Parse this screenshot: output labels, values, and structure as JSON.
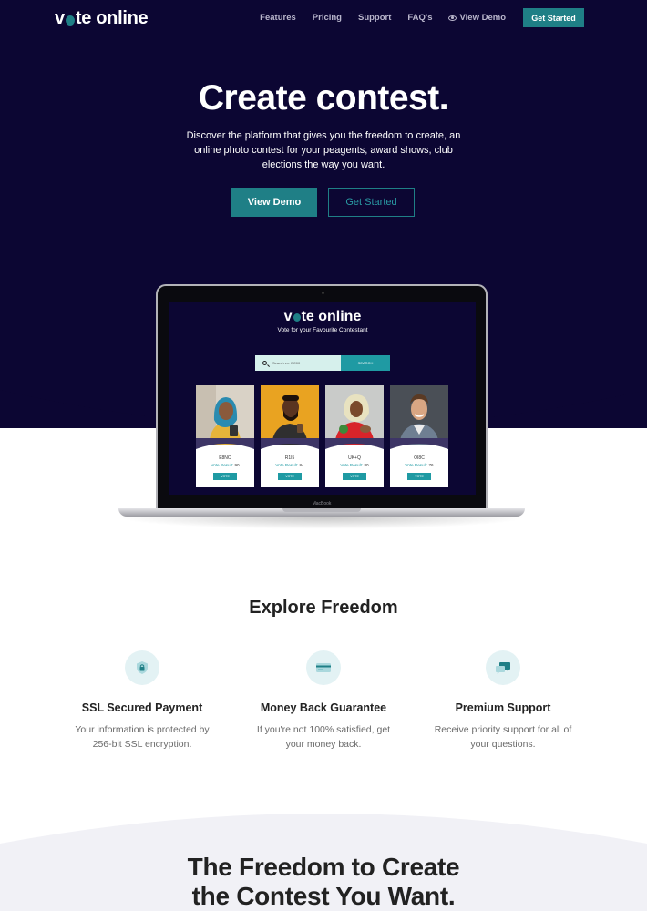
{
  "nav": {
    "logo_pre": "v",
    "logo_post": "te online",
    "links": [
      "Features",
      "Pricing",
      "Support",
      "FAQ's"
    ],
    "demo_link": "View Demo",
    "cta": "Get Started"
  },
  "hero": {
    "title": "Create contest.",
    "subtitle": "Discover the platform that gives you the freedom to create, an online photo contest for your peagents, award shows, club elections the way you want.",
    "btn_demo": "View Demo",
    "btn_start": "Get Started"
  },
  "laptop": {
    "brand": "MacBook",
    "screen": {
      "logo_pre": "v",
      "logo_post": "te online",
      "tagline": "Vote for your Favourite Contestant",
      "search_placeholder": "Search ex: EC00",
      "search_button": "SEARCH",
      "cards": [
        {
          "code": "E8NO",
          "result_label": "Vote Result:",
          "result_value": "90",
          "vote": "VOTE"
        },
        {
          "code": "R1I5",
          "result_label": "Vote Result:",
          "result_value": "84",
          "vote": "VOTE"
        },
        {
          "code": "UK+Q",
          "result_label": "Vote Result:",
          "result_value": "80",
          "vote": "VOTE"
        },
        {
          "code": "OI8C",
          "result_label": "Vote Result:",
          "result_value": "76",
          "vote": "VOTE"
        }
      ]
    }
  },
  "features": {
    "title": "Explore Freedom",
    "items": [
      {
        "icon": "shield-lock-icon",
        "title": "SSL Secured Payment",
        "desc": "Your information is protected by 256-bit SSL encryption."
      },
      {
        "icon": "credit-card-icon",
        "title": "Money Back Guarantee",
        "desc": "If you're not 100% satisfied, get your money back."
      },
      {
        "icon": "chat-bubbles-icon",
        "title": "Premium Support",
        "desc": "Receive priority support for all of your questions."
      }
    ]
  },
  "bottom": {
    "title_line1": "The Freedom to Create",
    "title_line2": "the Contest You Want."
  },
  "colors": {
    "hero_bg": "#0c0633",
    "accent": "#1f7f86",
    "icon_bg": "#e3f2f4",
    "bottom_bg": "#f1f1f6"
  }
}
